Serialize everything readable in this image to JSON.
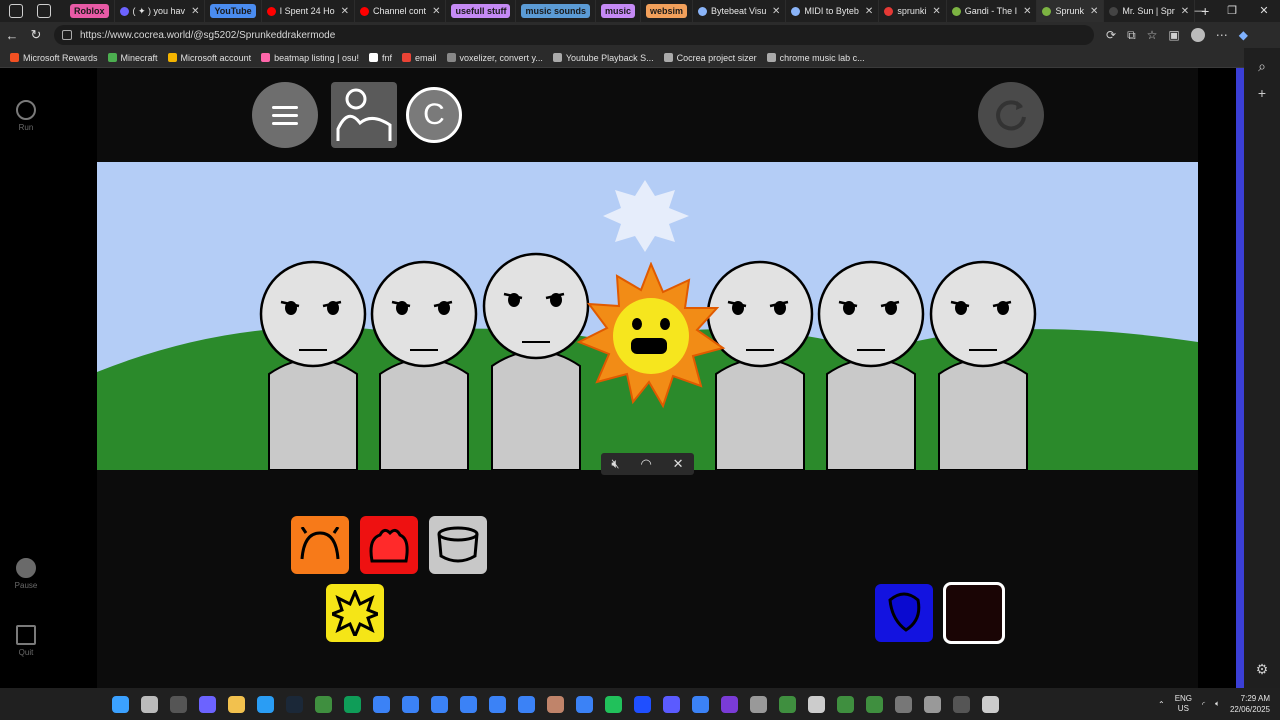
{
  "browser": {
    "tabs": [
      {
        "label": "Roblox",
        "style": "pill",
        "color": "#e85aa6"
      },
      {
        "label": "( ✦ ) you hav",
        "style": "tab",
        "color": "#6c63ff"
      },
      {
        "label": "YouTube",
        "style": "pill",
        "color": "#4a8cf0"
      },
      {
        "label": "I Spent 24 Ho",
        "style": "tab",
        "color": "#ff0000"
      },
      {
        "label": "Channel cont",
        "style": "tab",
        "color": "#ff0000"
      },
      {
        "label": "usefull stuff",
        "style": "pill",
        "color": "#c58af5"
      },
      {
        "label": "music sounds",
        "style": "pill",
        "color": "#5b9bd5"
      },
      {
        "label": "music",
        "style": "pill",
        "color": "#c58af5"
      },
      {
        "label": "websim",
        "style": "pill",
        "color": "#f2a05b"
      },
      {
        "label": "Bytebeat Visu",
        "style": "tab",
        "color": "#8ab4f8"
      },
      {
        "label": "MIDI to Byteb",
        "style": "tab",
        "color": "#8ab4f8"
      },
      {
        "label": "sprunki",
        "style": "tab",
        "color": "#e53935"
      },
      {
        "label": "Gandi - The I",
        "style": "tab",
        "color": "#7cb342"
      },
      {
        "label": "Sprunk",
        "style": "tab",
        "color": "#7cb342",
        "active": true
      },
      {
        "label": "Mr. Sun | Spr",
        "style": "tab",
        "color": "#444"
      }
    ],
    "url": "https://www.cocrea.world/@sg5202/Sprunkeddrakermode",
    "bookmarks": [
      {
        "label": "Microsoft Rewards",
        "color": "#f25022"
      },
      {
        "label": "Minecraft",
        "color": "#4caf50"
      },
      {
        "label": "Microsoft account",
        "color": "#f4b400"
      },
      {
        "label": "beatmap listing | osu!",
        "color": "#ff66aa"
      },
      {
        "label": "fnf",
        "color": "#ffffff"
      },
      {
        "label": "email",
        "color": "#ea4335"
      },
      {
        "label": "voxelizer, convert y...",
        "color": "#888"
      },
      {
        "label": "Youtube Playback S...",
        "color": "#aaa"
      },
      {
        "label": "Cocrea project sizer",
        "color": "#aaa"
      },
      {
        "label": "chrome music lab c...",
        "color": "#aaa"
      }
    ]
  },
  "rail": {
    "run": "Run",
    "pause": "Pause",
    "quit": "Quit"
  },
  "game": {
    "c_label": "C",
    "characters": 6,
    "icons": [
      {
        "name": "orange-sound",
        "color": "#f77a19"
      },
      {
        "name": "red-sound",
        "color": "#ee1111"
      },
      {
        "name": "grey-sound",
        "color": "#c8c8c8"
      },
      {
        "name": "yellow-sun-sound",
        "color": "#f5e517"
      },
      {
        "name": "blue-sound",
        "color": "#1313e0"
      },
      {
        "name": "dark-sound",
        "color": "#1a0505"
      }
    ]
  },
  "taskbar": {
    "lang1": "ENG",
    "lang2": "US",
    "time": "7:29 AM",
    "date": "22/06/2025"
  }
}
